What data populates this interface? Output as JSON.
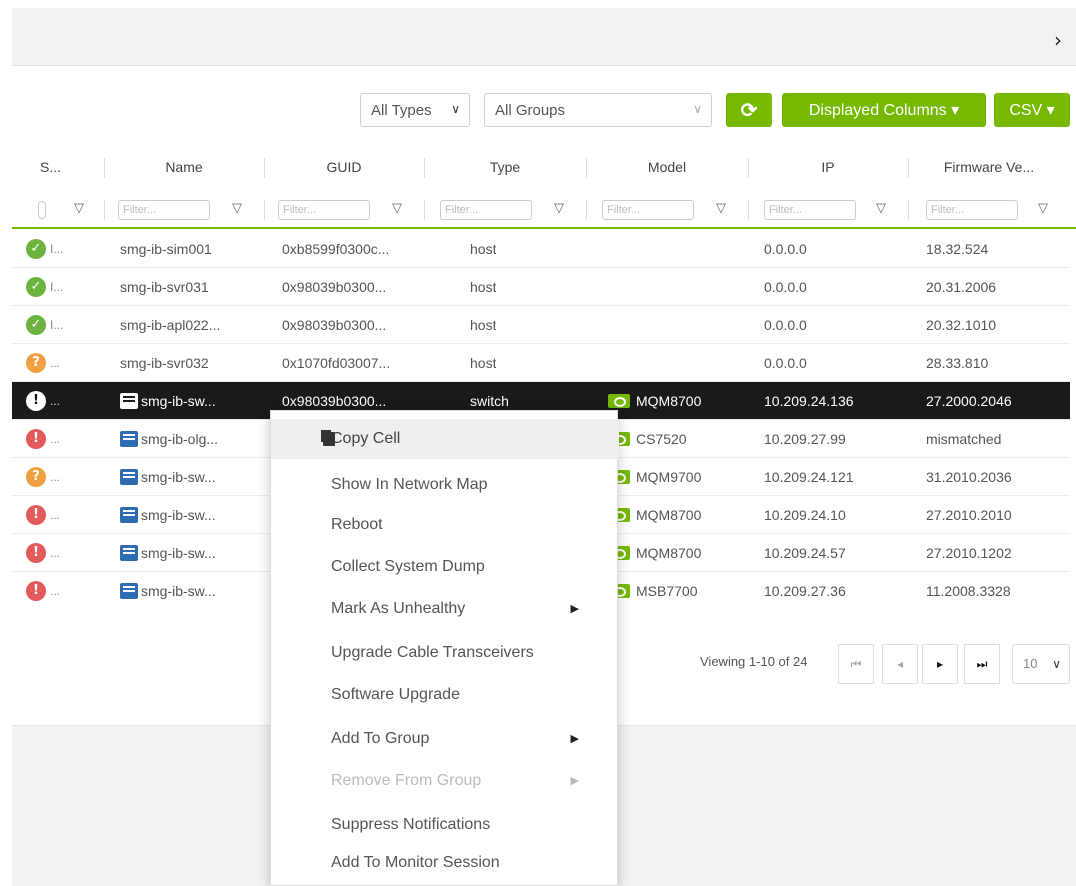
{
  "top": {
    "expand_glyph": "›"
  },
  "toolbar": {
    "types_select": "All Types",
    "groups_select": "All Groups",
    "refresh_glyph": "⟳",
    "displayed_columns": "Displayed Columns ▾",
    "csv": "CSV ▾"
  },
  "columns": [
    "S...",
    "Name",
    "GUID",
    "Type",
    "Model",
    "IP",
    "Firmware Ve..."
  ],
  "filter_placeholder": "Filter...",
  "rows": [
    {
      "status": "ok",
      "status_text": "I...",
      "name": "smg-ib-sim001",
      "guid": "0xb8599f0300c...",
      "type": "host",
      "model": "",
      "ip": "0.0.0.0",
      "fw": "18.32.524"
    },
    {
      "status": "ok",
      "status_text": "I...",
      "name": "smg-ib-svr031",
      "guid": "0x98039b0300...",
      "type": "host",
      "model": "",
      "ip": "0.0.0.0",
      "fw": "20.31.2006"
    },
    {
      "status": "ok",
      "status_text": "I...",
      "name": "smg-ib-apl022...",
      "guid": "0x98039b0300...",
      "type": "host",
      "model": "",
      "ip": "0.0.0.0",
      "fw": "20.32.1010"
    },
    {
      "status": "warn",
      "status_text": "...",
      "name": "smg-ib-svr032",
      "guid": "0x1070fd03007...",
      "type": "host",
      "model": "",
      "ip": "0.0.0.0",
      "fw": "28.33.810"
    },
    {
      "status": "crit",
      "status_text": "...",
      "name": "smg-ib-sw...",
      "guid": "0x98039b0300...",
      "type": "switch",
      "model": "MQM8700",
      "ip": "10.209.24.136",
      "fw": "27.2000.2046"
    },
    {
      "status": "err",
      "status_text": "...",
      "name": "smg-ib-olg...",
      "guid": "",
      "type": "",
      "model": "CS7520",
      "ip": "10.209.27.99",
      "fw": "mismatched"
    },
    {
      "status": "warn",
      "status_text": "...",
      "name": "smg-ib-sw...",
      "guid": "",
      "type": "",
      "model": "MQM9700",
      "ip": "10.209.24.121",
      "fw": "31.2010.2036"
    },
    {
      "status": "err",
      "status_text": "...",
      "name": "smg-ib-sw...",
      "guid": "",
      "type": "",
      "model": "MQM8700",
      "ip": "10.209.24.10",
      "fw": "27.2010.2010"
    },
    {
      "status": "err",
      "status_text": "...",
      "name": "smg-ib-sw...",
      "guid": "",
      "type": "",
      "model": "MQM8700",
      "ip": "10.209.24.57",
      "fw": "27.2010.1202"
    },
    {
      "status": "err",
      "status_text": "...",
      "name": "smg-ib-sw...",
      "guid": "",
      "type": "",
      "model": "MSB7700",
      "ip": "10.209.27.36",
      "fw": "11.2008.3328"
    }
  ],
  "pager": {
    "viewing": "Viewing 1-10 of 24",
    "first": "⏮",
    "prev": "◂",
    "next": "▸",
    "last": "⏭",
    "page_size": "10"
  },
  "context_menu": [
    {
      "label": "Copy Cell",
      "submenu": false,
      "disabled": false,
      "highlight": true
    },
    {
      "label": "Show In Network Map",
      "submenu": false,
      "disabled": false
    },
    {
      "label": "Reboot",
      "submenu": false,
      "disabled": false
    },
    {
      "label": "Collect System Dump",
      "submenu": false,
      "disabled": false
    },
    {
      "label": "Mark As Unhealthy",
      "submenu": true,
      "disabled": false
    },
    {
      "label": "Upgrade Cable Transceivers",
      "submenu": false,
      "disabled": false
    },
    {
      "label": "Software Upgrade",
      "submenu": false,
      "disabled": false
    },
    {
      "label": "Add To Group",
      "submenu": true,
      "disabled": false
    },
    {
      "label": "Remove From Group",
      "submenu": true,
      "disabled": true
    },
    {
      "label": "Suppress Notifications",
      "submenu": false,
      "disabled": false
    },
    {
      "label": "Add To Monitor Session",
      "submenu": false,
      "disabled": false
    }
  ],
  "colors": {
    "accent": "#76b900",
    "selected_row": "#1a1a1a",
    "ok": "#6db33f",
    "warn": "#f0a040",
    "err": "#e35a5a"
  }
}
